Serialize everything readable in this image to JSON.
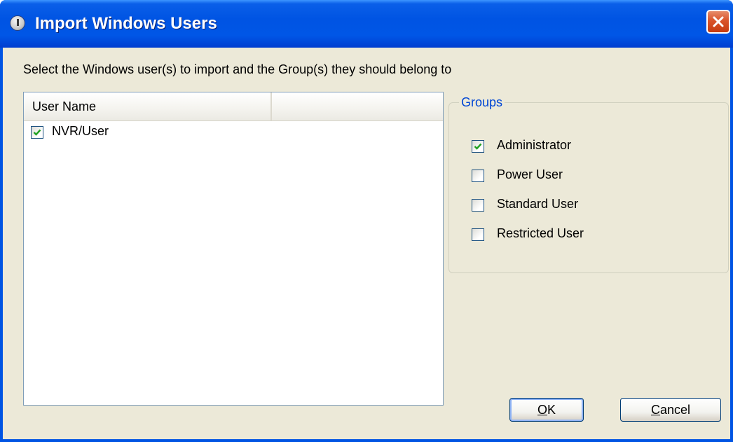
{
  "window": {
    "title": "Import Windows Users"
  },
  "instruction": "Select the Windows user(s) to import and the Group(s) they should belong to",
  "user_list": {
    "columns": [
      "User Name"
    ],
    "rows": [
      {
        "label": "NVR/User",
        "checked": true
      }
    ]
  },
  "groups": {
    "legend": "Groups",
    "items": [
      {
        "label": "Administrator",
        "checked": true
      },
      {
        "label": "Power User",
        "checked": false
      },
      {
        "label": "Standard User",
        "checked": false
      },
      {
        "label": "Restricted User",
        "checked": false
      }
    ]
  },
  "buttons": {
    "ok_mnemonic": "O",
    "ok_rest": "K",
    "cancel_mnemonic": "C",
    "cancel_rest": "ancel"
  },
  "colors": {
    "titlebar": "#0054e3",
    "dialog_bg": "#ece9d8",
    "group_legend": "#0046d5",
    "check": "#21a121"
  },
  "icons": {
    "title_icon": "info-disk-icon",
    "close_icon": "close-x-icon",
    "check_icon": "checkmark-icon"
  }
}
